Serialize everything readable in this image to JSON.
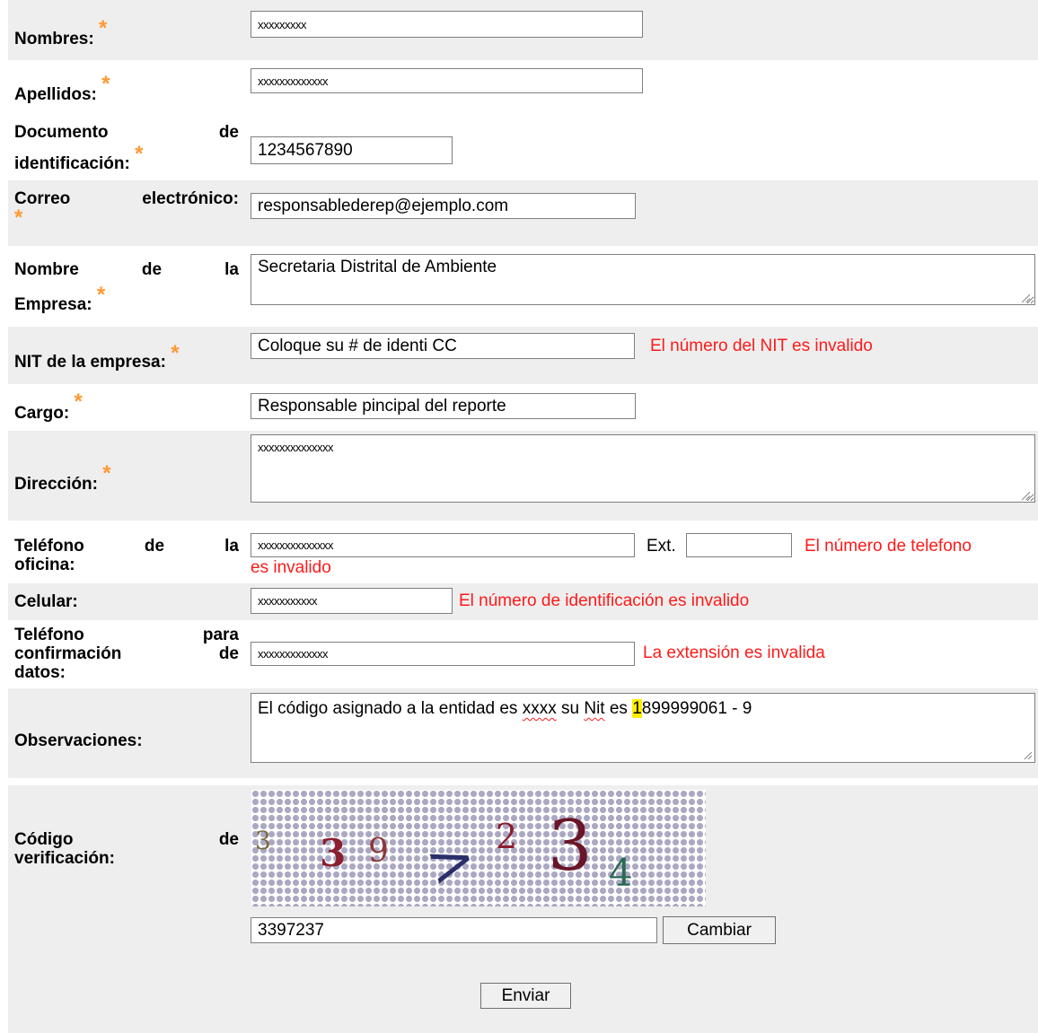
{
  "required_marker": "*",
  "colors": {
    "required": "#ff9933",
    "error": "#ff1a1a",
    "row_alt": "#eeeeee"
  },
  "fields": {
    "nombres": {
      "label": "Nombres:",
      "value": "xxxxxxxxx"
    },
    "apellidos": {
      "label": "Apellidos:",
      "value": "xxxxxxxxxxxxx"
    },
    "documento": {
      "label_line1_a": "Documento",
      "label_line1_b": "de",
      "label_line2": "identificación:",
      "value": "1234567890"
    },
    "correo": {
      "label_a": "Correo",
      "label_b": "electrónico:",
      "value": "responsablederep@ejemplo.com"
    },
    "empresa": {
      "label_line1_a": "Nombre",
      "label_line1_b": "de",
      "label_line1_c": "la",
      "label_line2": "Empresa:",
      "value": "Secretaria Distrital de Ambiente"
    },
    "nit": {
      "label": "NIT de la empresa:",
      "value": "Coloque su # de identi CC",
      "error": "El número del NIT es invalido"
    },
    "cargo": {
      "label": "Cargo:",
      "value": "Responsable pincipal del reporte"
    },
    "direccion": {
      "label": "Dirección:",
      "value": "xxxxxxxxxxxxxx"
    },
    "telefono_oficina": {
      "label_line1_a": "Teléfono",
      "label_line1_b": "de",
      "label_line1_c": "la",
      "label_line2": "oficina:",
      "value": "xxxxxxxxxxxxxx",
      "ext_label": "Ext.",
      "ext_value": "",
      "error_line1": "El número de telefono",
      "error_line2": "es invalido"
    },
    "celular": {
      "label": "Celular:",
      "value": "xxxxxxxxxxx",
      "error": "El número de identificación es invalido"
    },
    "telefono_confirmacion": {
      "label_line1_a": "Teléfono",
      "label_line1_b": "para",
      "label_line2_a": "confirmación",
      "label_line2_b": "de",
      "label_line3": "datos:",
      "value": "xxxxxxxxxxxxx",
      "error": "La extensión es invalida"
    },
    "observaciones": {
      "label": "Observaciones:",
      "value_parts": {
        "p1": "El código asignado a la entidad es ",
        "w1": "xxxx",
        "p2": " su ",
        "w2": "Nit",
        "p3": " es ",
        "hl": "1",
        "p4": "899999061 - 9"
      }
    },
    "codigo": {
      "label_line1_a": "Código",
      "label_line1_b": "de",
      "label_line2": "verificación:",
      "captcha_chars": [
        "3",
        "3",
        "9",
        ">",
        "2",
        "3",
        "4"
      ],
      "value": "3397237",
      "change_button": "Cambiar"
    }
  },
  "submit_button": "Enviar"
}
